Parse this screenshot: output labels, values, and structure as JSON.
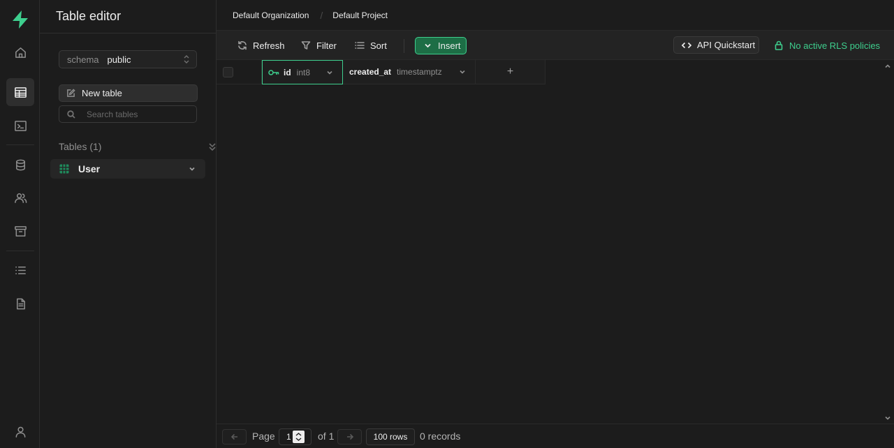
{
  "sidebar": {
    "title": "Table editor",
    "schema": {
      "label": "schema",
      "value": "public"
    },
    "new_table_label": "New table",
    "search_placeholder": "Search tables",
    "tables_heading": "Tables (1)",
    "tables": [
      {
        "name": "User"
      }
    ]
  },
  "breadcrumb": {
    "organization": "Default Organization",
    "project": "Default Project"
  },
  "toolbar": {
    "refresh_label": "Refresh",
    "filter_label": "Filter",
    "sort_label": "Sort",
    "insert_label": "Insert",
    "api_label": "API Quickstart",
    "rls_label": "No active RLS policies"
  },
  "grid": {
    "columns": [
      {
        "name": "id",
        "type": "int8",
        "primary_key": true
      },
      {
        "name": "created_at",
        "type": "timestamptz",
        "primary_key": false
      }
    ],
    "add_column_label": "+"
  },
  "footer": {
    "page_label": "Page",
    "page_value": "1",
    "of_label": "of 1",
    "rows_label": "100 rows",
    "records_label": "0 records"
  },
  "colors": {
    "brand": "#3ecf8e",
    "background": "#1c1c1c"
  }
}
